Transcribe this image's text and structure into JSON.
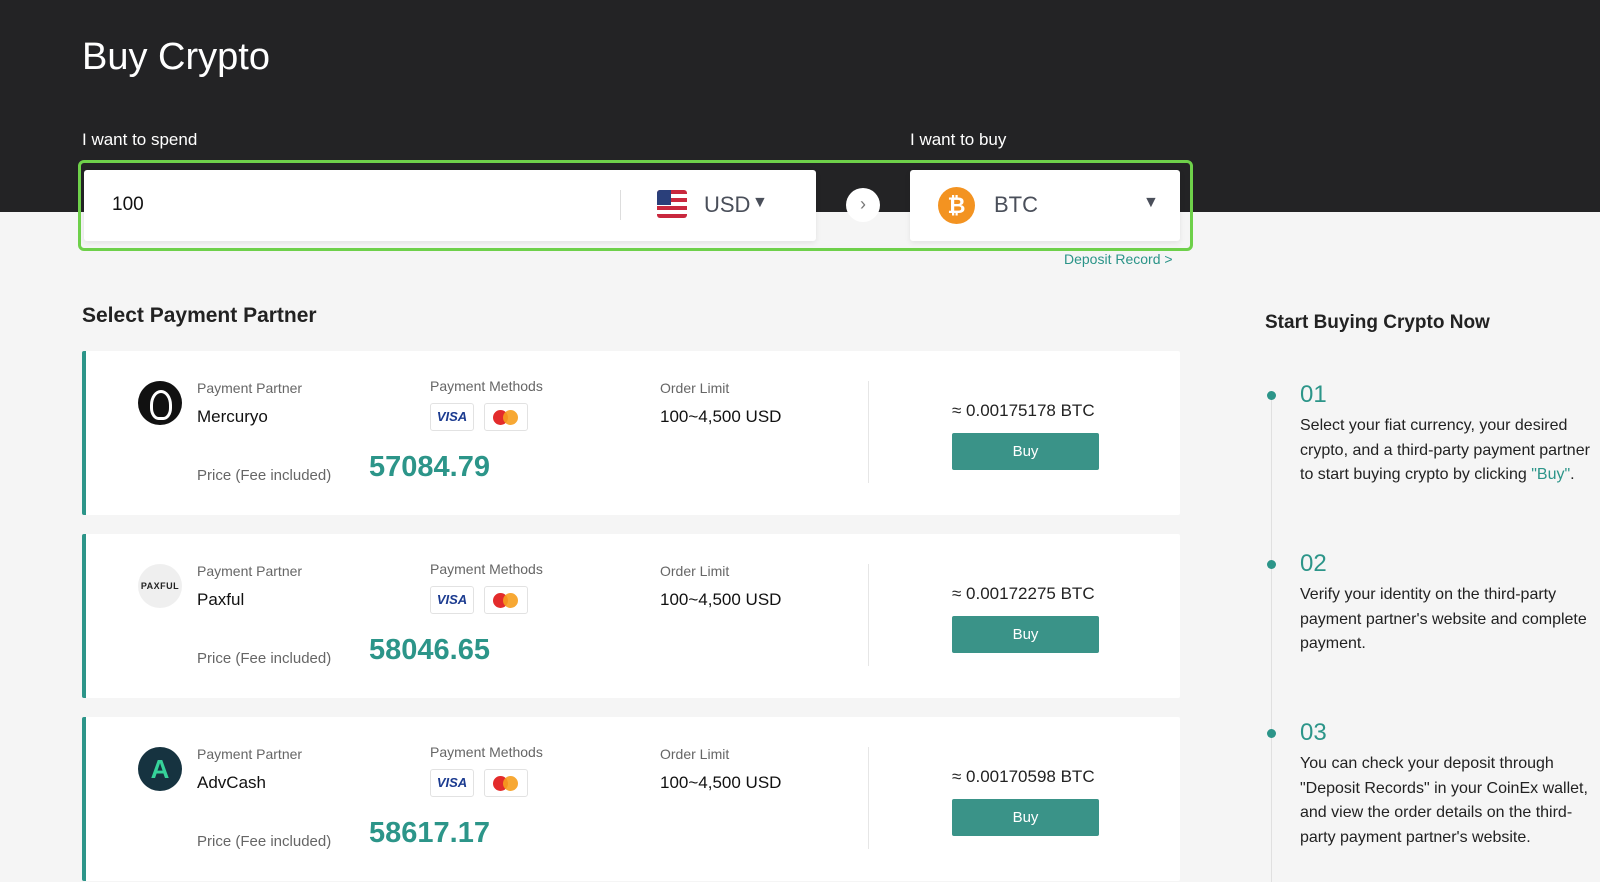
{
  "header": {
    "title": "Buy Crypto",
    "spend_label": "I want to spend",
    "buy_label": "I want to buy"
  },
  "spend": {
    "amount": "100",
    "currency": "USD",
    "flag_icon": "us-flag-icon"
  },
  "buy": {
    "currency": "BTC",
    "icon": "bitcoin-icon"
  },
  "deposit_record_link": "Deposit Record >",
  "section_title": "Select Payment Partner",
  "labels": {
    "partner": "Payment Partner",
    "methods": "Payment Methods",
    "limit": "Order Limit",
    "price": "Price (Fee included)"
  },
  "partners": [
    {
      "name": "Mercuryo",
      "methods": [
        "VISA",
        "Mastercard"
      ],
      "order_limit": "100~4,500 USD",
      "price": "57084.79",
      "estimate": "≈ 0.00175178 BTC",
      "buy_label": "Buy"
    },
    {
      "name": "Paxful",
      "logo_text": "PAXFUL",
      "methods": [
        "VISA",
        "Mastercard"
      ],
      "order_limit": "100~4,500 USD",
      "price": "58046.65",
      "estimate": "≈ 0.00172275 BTC",
      "buy_label": "Buy"
    },
    {
      "name": "AdvCash",
      "logo_text": "A",
      "methods": [
        "VISA",
        "Mastercard"
      ],
      "order_limit": "100~4,500 USD",
      "price": "58617.17",
      "estimate": "≈ 0.00170598 BTC",
      "buy_label": "Buy"
    }
  ],
  "sidebar": {
    "title": "Start Buying Crypto Now",
    "steps": [
      {
        "num": "01",
        "text_before": "Select your fiat currency, your desired crypto, and a third-party payment partner to start buying crypto by clicking ",
        "highlight": "\"Buy\"",
        "text_after": "."
      },
      {
        "num": "02",
        "text": "Verify your identity on the third-party payment partner's website and complete payment."
      },
      {
        "num": "03",
        "text": "You can check your deposit through \"Deposit Records\" in your CoinEx wallet, and view the order details on the third-party payment partner's website."
      }
    ]
  },
  "colors": {
    "accent": "#2c9589",
    "header_bg": "#232325",
    "highlight_border": "#6ed04a",
    "bitcoin": "#f39321"
  }
}
